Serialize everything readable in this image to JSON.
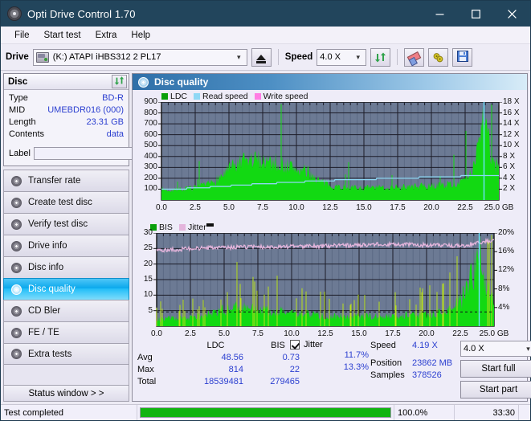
{
  "window": {
    "title": "Opti Drive Control 1.70",
    "icon": "disc-icon",
    "minimize_label": "—",
    "maximize_label": "□",
    "close_label": "✕"
  },
  "menu": {
    "items": [
      "File",
      "Start test",
      "Extra",
      "Help"
    ]
  },
  "toolbar": {
    "drive_label": "Drive",
    "drive_value": "(K:)  ATAPI iHBS312   2 PL17",
    "eject_title": "eject-button",
    "speed_label": "Speed",
    "speed_value": "4.0 X",
    "refresh_title": "refresh-button",
    "erase_title": "erase-button",
    "settings_title": "settings-button",
    "save_title": "save-button"
  },
  "disc_panel": {
    "title": "Disc",
    "refresh_title": "refresh-disc-button",
    "rows": [
      {
        "key": "Type",
        "value": "BD-R"
      },
      {
        "key": "MID",
        "value": "UMEBDR016 (000)"
      },
      {
        "key": "Length",
        "value": "23.31 GB"
      },
      {
        "key": "Contents",
        "value": "data"
      }
    ],
    "label_key": "Label",
    "label_value": "",
    "label_placeholder": ""
  },
  "sidebar": {
    "items": [
      {
        "label": "Transfer rate",
        "active": false
      },
      {
        "label": "Create test disc",
        "active": false
      },
      {
        "label": "Verify test disc",
        "active": false
      },
      {
        "label": "Drive info",
        "active": false
      },
      {
        "label": "Disc info",
        "active": false
      },
      {
        "label": "Disc quality",
        "active": true
      },
      {
        "label": "CD Bler",
        "active": false
      },
      {
        "label": "FE / TE",
        "active": false
      },
      {
        "label": "Extra tests",
        "active": false
      }
    ],
    "status_window_label": "Status window > >"
  },
  "main": {
    "header_title": "Disc quality",
    "header_icon": "disc-quality-icon"
  },
  "stats": {
    "col_headers": [
      "LDC",
      "BIS"
    ],
    "jitter_label": "Jitter",
    "jitter_checked": true,
    "rows": [
      {
        "key": "Avg",
        "ldc": "48.56",
        "bis": "0.73",
        "jitter": "11.7%"
      },
      {
        "key": "Max",
        "ldc": "814",
        "bis": "22",
        "jitter": "13.3%"
      },
      {
        "key": "Total",
        "ldc": "18539481",
        "bis": "279465",
        "jitter": ""
      }
    ],
    "speed_key": "Speed",
    "speed_value": "4.19 X",
    "speed_select": "4.0 X",
    "position_key": "Position",
    "position_value": "23862 MB",
    "samples_key": "Samples",
    "samples_value": "378526",
    "start_full_label": "Start full",
    "start_part_label": "Start part"
  },
  "statusbar": {
    "message": "Test completed",
    "percent_label": "100.0%",
    "progress": 100,
    "time": "33:30"
  },
  "colors": {
    "titlebar": "#22455c",
    "accent_blue": "#2b3fd0",
    "plot_bg": "#6c7a94",
    "ldc_green": "#12d912",
    "bis_green": "#12d912",
    "read_speed": "#8fd8f5",
    "write_speed": "#ff7de3",
    "jitter_pink": "#e4b5dc",
    "progress_green": "#11b411",
    "selection_blue": "#0aa8ec"
  },
  "chart_data": [
    {
      "id": "ldc-chart",
      "type": "area",
      "title": "",
      "xlabel": "25.0 GB",
      "ylabel": "LDC",
      "xlim": [
        0,
        25
      ],
      "xticks": [
        "0.0",
        "2.5",
        "5.0",
        "7.5",
        "10.0",
        "12.5",
        "15.0",
        "17.5",
        "20.0",
        "22.5",
        "25.0 GB"
      ],
      "ylim": [
        0,
        900
      ],
      "yticks": [
        100,
        200,
        300,
        400,
        500,
        600,
        700,
        800,
        900
      ],
      "y2lim": [
        0,
        18
      ],
      "y2ticks": [
        "2 X",
        "4 X",
        "6 X",
        "8 X",
        "10 X",
        "12 X",
        "14 X",
        "16 X",
        "18 X"
      ],
      "grid": true,
      "legend": [
        {
          "name": "LDC",
          "color": "#0aa00a"
        },
        {
          "name": "Read speed",
          "color": "#8fd8f5"
        },
        {
          "name": "Write speed",
          "color": "#ff7de3"
        }
      ],
      "series": [
        {
          "name": "LDC",
          "color": "#12d912",
          "x": [
            0.0,
            0.5,
            1.0,
            1.5,
            2.0,
            2.5,
            3.0,
            3.5,
            4.0,
            4.5,
            5.0,
            5.5,
            6.0,
            6.5,
            7.0,
            7.5,
            8.0,
            8.5,
            9.0,
            9.5,
            10.0,
            10.5,
            11.0,
            11.5,
            12.0,
            12.5,
            13.0,
            13.5,
            14.0,
            14.5,
            15.0,
            15.5,
            16.0,
            16.5,
            17.0,
            17.5,
            18.0,
            18.5,
            19.0,
            19.5,
            20.0,
            20.5,
            21.0,
            21.5,
            22.0,
            22.5,
            23.0,
            23.5,
            24.0,
            24.5
          ],
          "values": [
            95,
            90,
            92,
            95,
            100,
            110,
            120,
            140,
            175,
            215,
            270,
            300,
            330,
            345,
            355,
            360,
            340,
            330,
            315,
            295,
            275,
            255,
            230,
            190,
            150,
            130,
            120,
            115,
            110,
            108,
            108,
            110,
            110,
            112,
            112,
            115,
            115,
            118,
            120,
            122,
            125,
            130,
            135,
            140,
            150,
            170,
            240,
            560,
            820,
            300
          ]
        },
        {
          "name": "Read speed",
          "color": "#8fd8f5",
          "x": [
            0.0,
            2.5,
            5.0,
            7.5,
            10.0,
            12.5,
            15.0,
            17.5,
            20.0,
            22.5,
            24.5
          ],
          "values": [
            1.9,
            2.2,
            2.6,
            3.0,
            3.3,
            3.6,
            3.8,
            4.0,
            4.2,
            4.4,
            4.6
          ]
        },
        {
          "name": "Write speed",
          "color": "#ff7de3",
          "x": [],
          "values": []
        }
      ],
      "cursor_x": 23.9
    },
    {
      "id": "bis-jitter-chart",
      "type": "area",
      "title": "",
      "xlabel": "25.0 GB",
      "ylabel": "BIS",
      "xlim": [
        0,
        25
      ],
      "xticks": [
        "0.0",
        "2.5",
        "5.0",
        "7.5",
        "10.0",
        "12.5",
        "15.0",
        "17.5",
        "20.0",
        "22.5",
        "25.0 GB"
      ],
      "ylim": [
        0,
        30
      ],
      "yticks": [
        5,
        10,
        15,
        20,
        25,
        30
      ],
      "y2lim": [
        0,
        20
      ],
      "y2ticks": [
        "4%",
        "8%",
        "12%",
        "16%",
        "20%"
      ],
      "grid": true,
      "legend": [
        {
          "name": "BIS",
          "color": "#0aa00a"
        },
        {
          "name": "Jitter",
          "color": "#e4b5dc"
        }
      ],
      "series": [
        {
          "name": "BIS",
          "color": "#12d912",
          "x": [
            0.0,
            0.5,
            1.0,
            1.5,
            2.0,
            2.5,
            3.0,
            3.5,
            4.0,
            4.5,
            5.0,
            5.5,
            6.0,
            6.5,
            7.0,
            7.5,
            8.0,
            8.5,
            9.0,
            9.5,
            10.0,
            10.5,
            11.0,
            11.5,
            12.0,
            12.5,
            13.0,
            13.5,
            14.0,
            14.5,
            15.0,
            15.5,
            16.0,
            16.5,
            17.0,
            17.5,
            18.0,
            18.5,
            19.0,
            19.5,
            20.0,
            20.5,
            21.0,
            21.5,
            22.0,
            22.5,
            23.0,
            23.5,
            24.0,
            24.5
          ],
          "values": [
            2.0,
            2.2,
            2.4,
            2.3,
            2.5,
            2.6,
            2.8,
            3.2,
            3.8,
            4.4,
            5.0,
            5.4,
            5.6,
            5.4,
            5.2,
            5.0,
            4.8,
            4.6,
            4.4,
            4.2,
            4.0,
            3.8,
            3.6,
            3.4,
            3.2,
            3.0,
            3.0,
            3.0,
            2.9,
            2.9,
            2.9,
            2.9,
            3.0,
            3.0,
            3.0,
            3.1,
            3.1,
            3.2,
            3.2,
            3.3,
            3.4,
            3.6,
            4.0,
            4.6,
            5.6,
            7.5,
            11.0,
            17.0,
            22.0,
            10.0
          ]
        },
        {
          "name": "Jitter",
          "color": "#e4b5dc",
          "x": [
            0.0,
            2.5,
            5.0,
            7.5,
            10.0,
            12.5,
            15.0,
            17.5,
            20.0,
            22.5,
            24.5
          ],
          "values": [
            16.3,
            16.6,
            16.9,
            17.0,
            17.1,
            17.2,
            17.4,
            17.6,
            17.4,
            17.2,
            18.2
          ]
        }
      ],
      "cursor_x": 23.9
    }
  ]
}
